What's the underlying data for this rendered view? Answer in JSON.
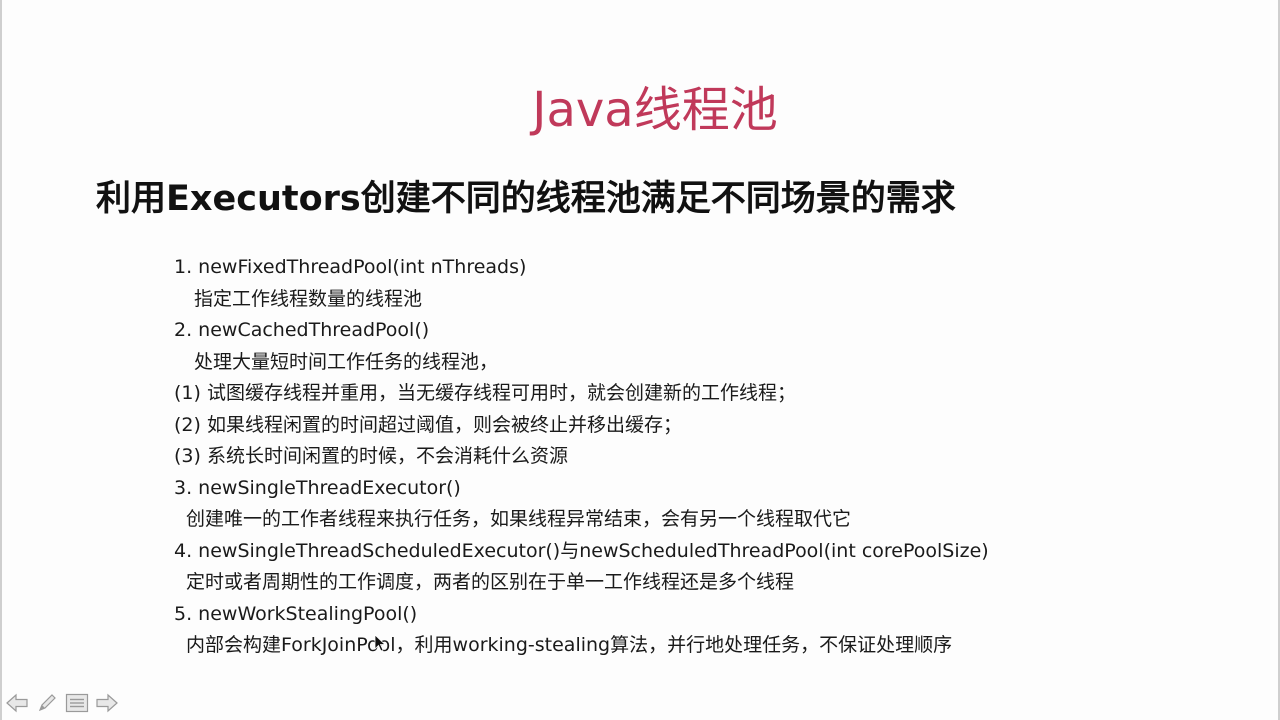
{
  "slide": {
    "title": "Java线程池",
    "subtitle": "利用Executors创建不同的线程池满足不同场景的需求",
    "lines": [
      {
        "text": "1. newFixedThreadPool(int nThreads)",
        "kind": "item"
      },
      {
        "text": "指定工作线程数量的线程池",
        "kind": "sub1"
      },
      {
        "text": "2. newCachedThreadPool()",
        "kind": "item"
      },
      {
        "text": "处理大量短时间工作任务的线程池，",
        "kind": "sub1"
      },
      {
        "text": "(1) 试图缓存线程并重用，当无缓存线程可用时，就会创建新的工作线程；",
        "kind": "para"
      },
      {
        "text": "(2) 如果线程闲置的时间超过阈值，则会被终止并移出缓存；",
        "kind": "para"
      },
      {
        "text": "(3) 系统长时间闲置的时候，不会消耗什么资源",
        "kind": "para"
      },
      {
        "text": "3. newSingleThreadExecutor()",
        "kind": "item"
      },
      {
        "text": "创建唯一的工作者线程来执行任务，如果线程异常结束，会有另一个线程取代它",
        "kind": "sub2"
      },
      {
        "text": "4. newSingleThreadScheduledExecutor()与newScheduledThreadPool(int corePoolSize)",
        "kind": "item"
      },
      {
        "text": "定时或者周期性的工作调度，两者的区别在于单一工作线程还是多个线程",
        "kind": "sub2"
      },
      {
        "text": "5. newWorkStealingPool()",
        "kind": "item"
      },
      {
        "text": "内部会构建ForkJoinPool，利用working-stealing算法，并行地处理任务，不保证处理顺序",
        "kind": "sub2"
      }
    ]
  },
  "nav": {
    "buttons": [
      {
        "name": "prev-arrow-icon"
      },
      {
        "name": "pen-icon"
      },
      {
        "name": "menu-icon"
      },
      {
        "name": "next-arrow-icon"
      }
    ]
  },
  "colors": {
    "title": "#c0395a",
    "text": "#1a1a1a"
  }
}
